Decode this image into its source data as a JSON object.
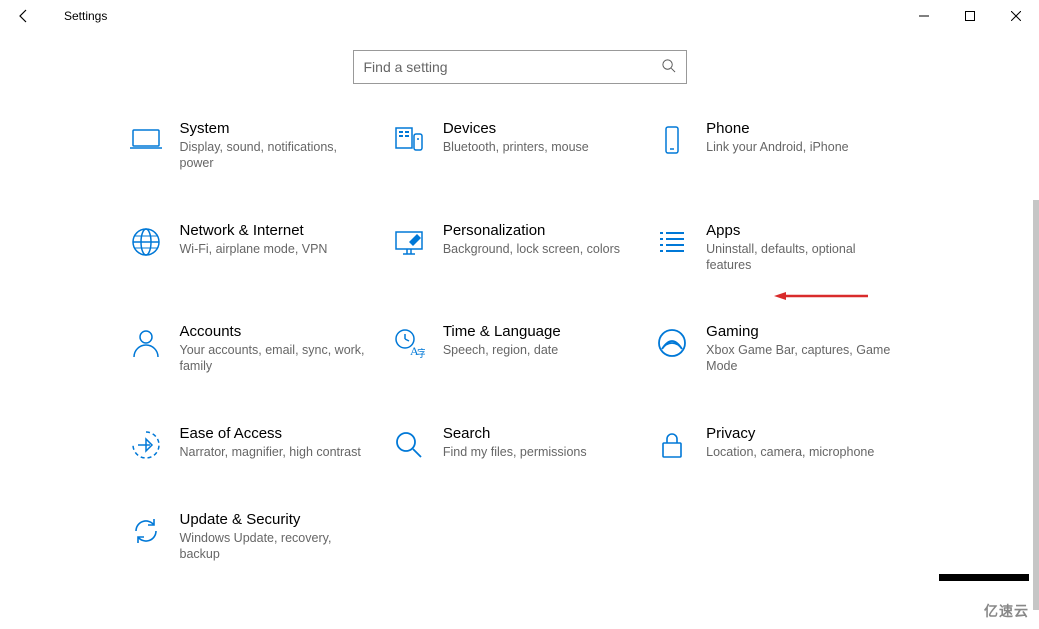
{
  "window": {
    "title": "Settings"
  },
  "search": {
    "placeholder": "Find a setting"
  },
  "tiles": {
    "system": {
      "title": "System",
      "desc": "Display, sound, notifications, power"
    },
    "devices": {
      "title": "Devices",
      "desc": "Bluetooth, printers, mouse"
    },
    "phone": {
      "title": "Phone",
      "desc": "Link your Android, iPhone"
    },
    "network": {
      "title": "Network & Internet",
      "desc": "Wi-Fi, airplane mode, VPN"
    },
    "personalization": {
      "title": "Personalization",
      "desc": "Background, lock screen, colors"
    },
    "apps": {
      "title": "Apps",
      "desc": "Uninstall, defaults, optional features"
    },
    "accounts": {
      "title": "Accounts",
      "desc": "Your accounts, email, sync, work, family"
    },
    "time": {
      "title": "Time & Language",
      "desc": "Speech, region, date"
    },
    "gaming": {
      "title": "Gaming",
      "desc": "Xbox Game Bar, captures, Game Mode"
    },
    "ease": {
      "title": "Ease of Access",
      "desc": "Narrator, magnifier, high contrast"
    },
    "search_cat": {
      "title": "Search",
      "desc": "Find my files, permissions"
    },
    "privacy": {
      "title": "Privacy",
      "desc": "Location, camera, microphone"
    },
    "update": {
      "title": "Update & Security",
      "desc": "Windows Update, recovery, backup"
    }
  },
  "annotation": {
    "arrow_target": "apps"
  },
  "watermark": "亿速云"
}
